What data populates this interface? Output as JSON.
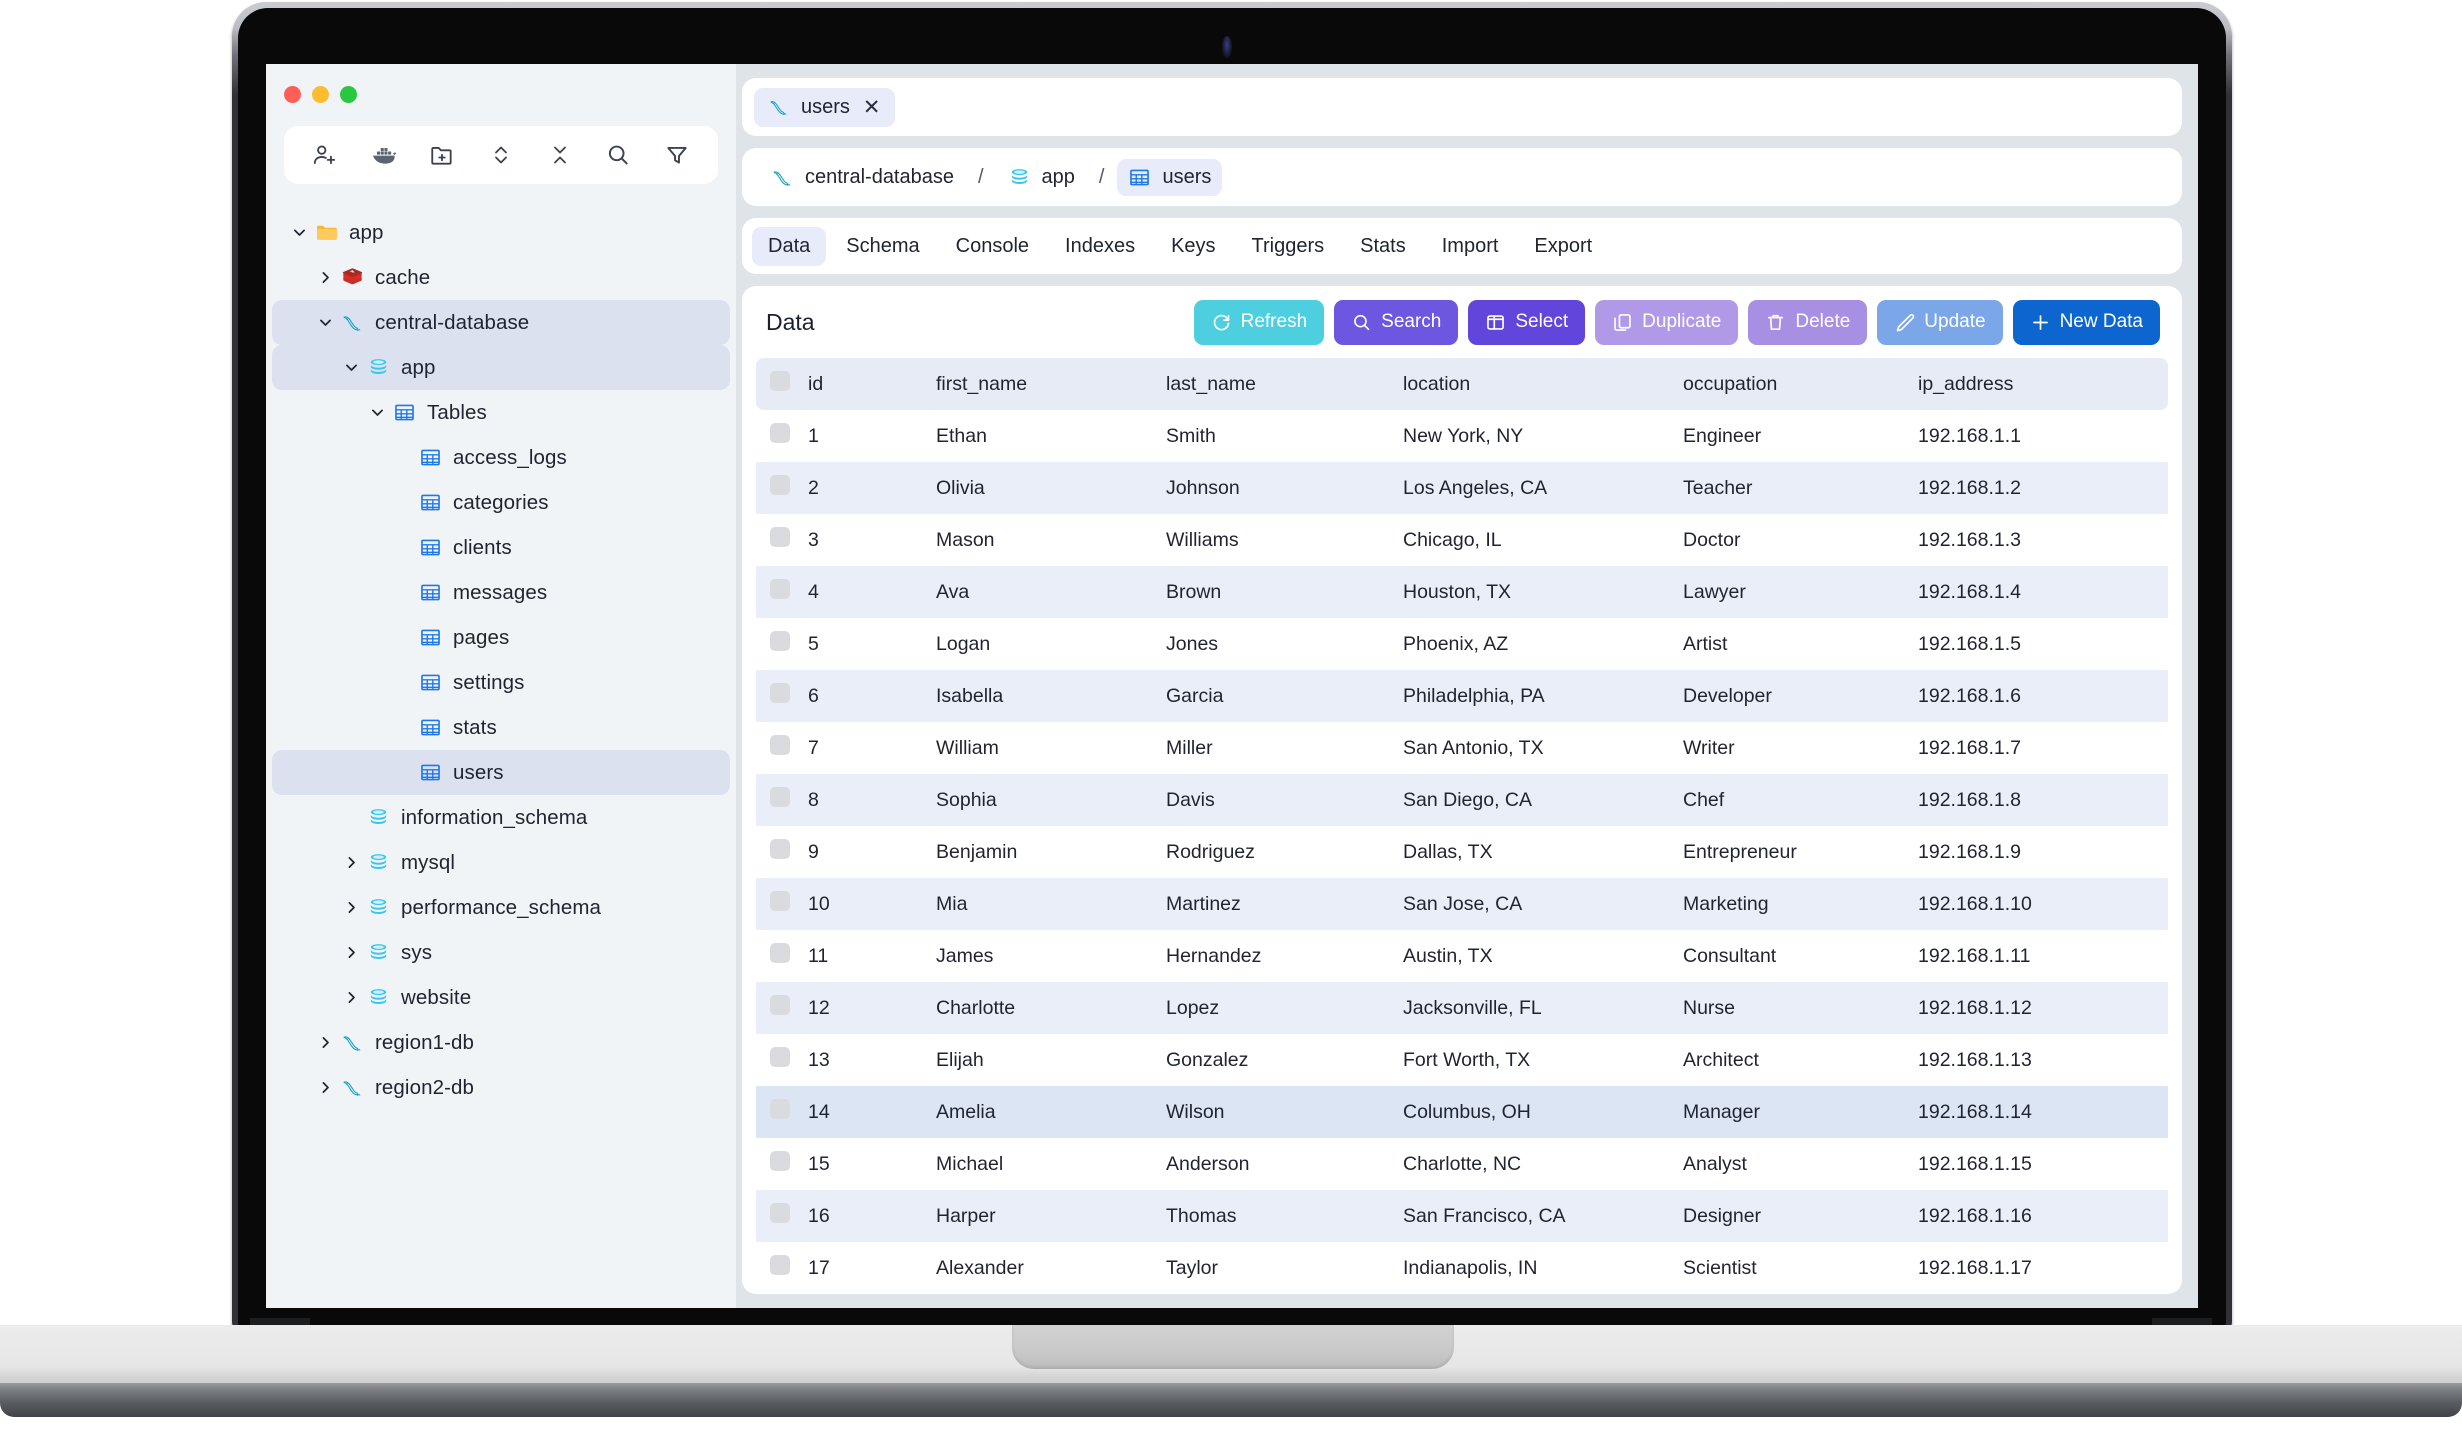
{
  "window": {
    "traffic_lights": [
      {
        "name": "close",
        "color": "#ff5f57"
      },
      {
        "name": "minimize",
        "color": "#febc2e"
      },
      {
        "name": "maximize",
        "color": "#28c840"
      }
    ]
  },
  "sidebar": {
    "toolbar": [
      {
        "icon": "add-user-icon",
        "name": "add-connection"
      },
      {
        "icon": "docker-icon",
        "name": "docker"
      },
      {
        "icon": "new-folder-icon",
        "name": "new-folder"
      },
      {
        "icon": "sort-icon",
        "name": "sort"
      },
      {
        "icon": "collapse-all-icon",
        "name": "collapse-all"
      },
      {
        "icon": "search-icon",
        "name": "search"
      },
      {
        "icon": "filter-icon",
        "name": "filter"
      }
    ],
    "tree": [
      {
        "label": "app",
        "icon": "folder-icon",
        "indent": 0,
        "chevron": "down",
        "selected": false
      },
      {
        "label": "cache",
        "icon": "redis-icon",
        "indent": 1,
        "chevron": "right",
        "selected": false
      },
      {
        "label": "central-database",
        "icon": "mysql-icon",
        "indent": 1,
        "chevron": "down",
        "selected": true
      },
      {
        "label": "app",
        "icon": "database-icon",
        "indent": 2,
        "chevron": "down",
        "selected": true
      },
      {
        "label": "Tables",
        "icon": "table-icon",
        "indent": 3,
        "chevron": "down",
        "selected": false
      },
      {
        "label": "access_logs",
        "icon": "table-icon",
        "indent": 4,
        "chevron": "none",
        "selected": false
      },
      {
        "label": "categories",
        "icon": "table-icon",
        "indent": 4,
        "chevron": "none",
        "selected": false
      },
      {
        "label": "clients",
        "icon": "table-icon",
        "indent": 4,
        "chevron": "none",
        "selected": false
      },
      {
        "label": "messages",
        "icon": "table-icon",
        "indent": 4,
        "chevron": "none",
        "selected": false
      },
      {
        "label": "pages",
        "icon": "table-icon",
        "indent": 4,
        "chevron": "none",
        "selected": false
      },
      {
        "label": "settings",
        "icon": "table-icon",
        "indent": 4,
        "chevron": "none",
        "selected": false
      },
      {
        "label": "stats",
        "icon": "table-icon",
        "indent": 4,
        "chevron": "none",
        "selected": false
      },
      {
        "label": "users",
        "icon": "table-icon",
        "indent": 4,
        "chevron": "none",
        "selected": true
      },
      {
        "label": "information_schema",
        "icon": "database-icon",
        "indent": 2,
        "chevron": "none",
        "selected": false
      },
      {
        "label": "mysql",
        "icon": "database-icon",
        "indent": 2,
        "chevron": "right",
        "selected": false
      },
      {
        "label": "performance_schema",
        "icon": "database-icon",
        "indent": 2,
        "chevron": "right",
        "selected": false
      },
      {
        "label": "sys",
        "icon": "database-icon",
        "indent": 2,
        "chevron": "right",
        "selected": false
      },
      {
        "label": "website",
        "icon": "database-icon",
        "indent": 2,
        "chevron": "right",
        "selected": false
      },
      {
        "label": "region1-db",
        "icon": "mysql-icon",
        "indent": 1,
        "chevron": "right",
        "selected": false
      },
      {
        "label": "region2-db",
        "icon": "mysql-icon",
        "indent": 1,
        "chevron": "right",
        "selected": false
      }
    ]
  },
  "document_tabs": [
    {
      "label": "users",
      "icon": "mysql-icon",
      "active": true,
      "close": "✕"
    }
  ],
  "breadcrumb": [
    {
      "label": "central-database",
      "icon": "mysql-icon",
      "active": false
    },
    {
      "label": "app",
      "icon": "database-icon",
      "active": false
    },
    {
      "label": "users",
      "icon": "table-icon",
      "active": true
    }
  ],
  "breadcrumb_separator": "/",
  "nav_tabs": [
    {
      "label": "Data",
      "active": true
    },
    {
      "label": "Schema",
      "active": false
    },
    {
      "label": "Console",
      "active": false
    },
    {
      "label": "Indexes",
      "active": false
    },
    {
      "label": "Keys",
      "active": false
    },
    {
      "label": "Triggers",
      "active": false
    },
    {
      "label": "Stats",
      "active": false
    },
    {
      "label": "Import",
      "active": false
    },
    {
      "label": "Export",
      "active": false
    }
  ],
  "content": {
    "title": "Data",
    "actions": [
      {
        "label": "Refresh",
        "icon": "refresh-icon",
        "color": "#4ecfe0"
      },
      {
        "label": "Search",
        "icon": "search-icon",
        "color": "#6d56e0"
      },
      {
        "label": "Select",
        "icon": "select-icon",
        "color": "#6246db"
      },
      {
        "label": "Duplicate",
        "icon": "duplicate-icon",
        "color": "#b09ae8"
      },
      {
        "label": "Delete",
        "icon": "trash-icon",
        "color": "#a78fe3"
      },
      {
        "label": "Update",
        "icon": "pencil-icon",
        "color": "#7ba7e8"
      },
      {
        "label": "New Data",
        "icon": "plus-icon",
        "color": "#0d66d0"
      }
    ]
  },
  "table": {
    "columns": [
      "id",
      "first_name",
      "last_name",
      "location",
      "occupation",
      "ip_address"
    ],
    "rows": [
      {
        "id": "1",
        "first_name": "Ethan",
        "last_name": "Smith",
        "location": "New York, NY",
        "occupation": "Engineer",
        "ip_address": "192.168.1.1",
        "highlight": false
      },
      {
        "id": "2",
        "first_name": "Olivia",
        "last_name": "Johnson",
        "location": "Los Angeles, CA",
        "occupation": "Teacher",
        "ip_address": "192.168.1.2",
        "highlight": false
      },
      {
        "id": "3",
        "first_name": "Mason",
        "last_name": "Williams",
        "location": "Chicago, IL",
        "occupation": "Doctor",
        "ip_address": "192.168.1.3",
        "highlight": false
      },
      {
        "id": "4",
        "first_name": "Ava",
        "last_name": "Brown",
        "location": "Houston, TX",
        "occupation": "Lawyer",
        "ip_address": "192.168.1.4",
        "highlight": false
      },
      {
        "id": "5",
        "first_name": "Logan",
        "last_name": "Jones",
        "location": "Phoenix, AZ",
        "occupation": "Artist",
        "ip_address": "192.168.1.5",
        "highlight": false
      },
      {
        "id": "6",
        "first_name": "Isabella",
        "last_name": "Garcia",
        "location": "Philadelphia, PA",
        "occupation": "Developer",
        "ip_address": "192.168.1.6",
        "highlight": false
      },
      {
        "id": "7",
        "first_name": "William",
        "last_name": "Miller",
        "location": "San Antonio, TX",
        "occupation": "Writer",
        "ip_address": "192.168.1.7",
        "highlight": false
      },
      {
        "id": "8",
        "first_name": "Sophia",
        "last_name": "Davis",
        "location": "San Diego, CA",
        "occupation": "Chef",
        "ip_address": "192.168.1.8",
        "highlight": false
      },
      {
        "id": "9",
        "first_name": "Benjamin",
        "last_name": "Rodriguez",
        "location": "Dallas, TX",
        "occupation": "Entrepreneur",
        "ip_address": "192.168.1.9",
        "highlight": false
      },
      {
        "id": "10",
        "first_name": "Mia",
        "last_name": "Martinez",
        "location": "San Jose, CA",
        "occupation": "Marketing",
        "ip_address": "192.168.1.10",
        "highlight": false
      },
      {
        "id": "11",
        "first_name": "James",
        "last_name": "Hernandez",
        "location": "Austin, TX",
        "occupation": "Consultant",
        "ip_address": "192.168.1.11",
        "highlight": false
      },
      {
        "id": "12",
        "first_name": "Charlotte",
        "last_name": "Lopez",
        "location": "Jacksonville, FL",
        "occupation": "Nurse",
        "ip_address": "192.168.1.12",
        "highlight": false
      },
      {
        "id": "13",
        "first_name": "Elijah",
        "last_name": "Gonzalez",
        "location": "Fort Worth, TX",
        "occupation": "Architect",
        "ip_address": "192.168.1.13",
        "highlight": false
      },
      {
        "id": "14",
        "first_name": "Amelia",
        "last_name": "Wilson",
        "location": "Columbus, OH",
        "occupation": "Manager",
        "ip_address": "192.168.1.14",
        "highlight": true
      },
      {
        "id": "15",
        "first_name": "Michael",
        "last_name": "Anderson",
        "location": "Charlotte, NC",
        "occupation": "Analyst",
        "ip_address": "192.168.1.15",
        "highlight": false
      },
      {
        "id": "16",
        "first_name": "Harper",
        "last_name": "Thomas",
        "location": "San Francisco, CA",
        "occupation": "Designer",
        "ip_address": "192.168.1.16",
        "highlight": false
      },
      {
        "id": "17",
        "first_name": "Alexander",
        "last_name": "Taylor",
        "location": "Indianapolis, IN",
        "occupation": "Scientist",
        "ip_address": "192.168.1.17",
        "highlight": false
      }
    ]
  }
}
